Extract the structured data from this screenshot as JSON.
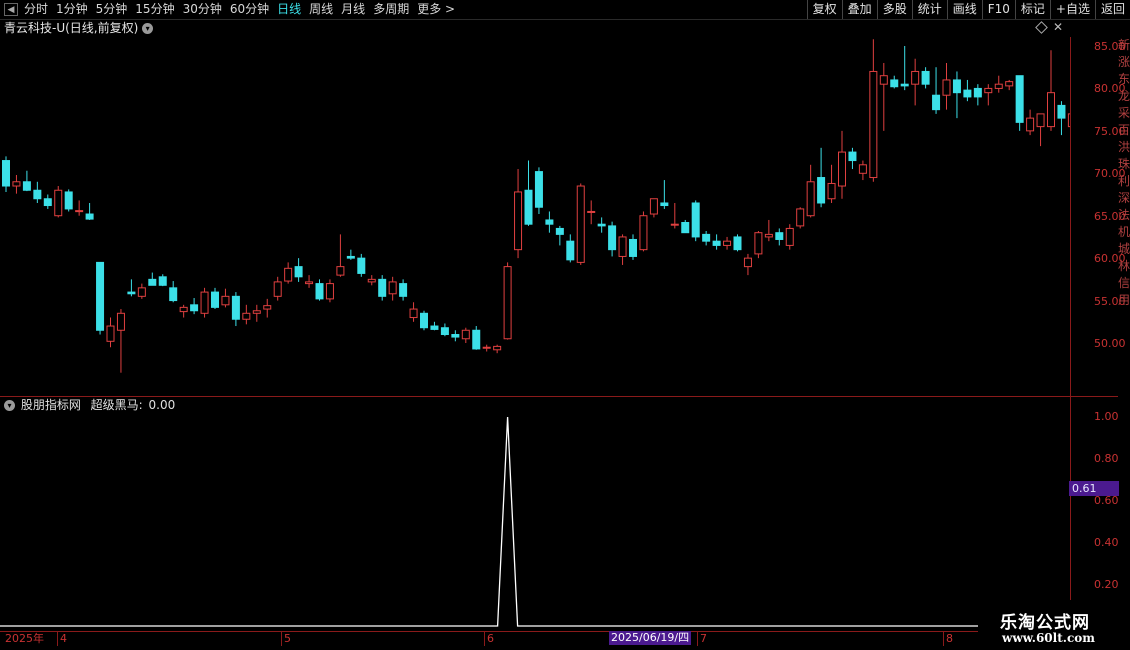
{
  "toolbar": {
    "periods": [
      "分时",
      "1分钟",
      "5分钟",
      "15分钟",
      "30分钟",
      "60分钟",
      "日线",
      "周线",
      "月线",
      "多周期",
      "更多 >"
    ],
    "active_period": "日线",
    "buttons": [
      "复权",
      "叠加",
      "多股",
      "统计",
      "画线",
      "F10",
      "标记",
      "+自选",
      "返回"
    ]
  },
  "stock": {
    "title": "青云科技-U(日线,前复权)"
  },
  "price_axis": [
    "85.00",
    "80.00",
    "75.00",
    "70.00",
    "65.00",
    "60.00",
    "55.00",
    "50.00"
  ],
  "indicator": {
    "name": "股朋指标网",
    "series_label": "超级黑马:",
    "series_value": "0.00",
    "axis": [
      "1.00",
      "0.80",
      "0.60",
      "0.40",
      "0.20"
    ],
    "cursor_value": "0.61"
  },
  "date_axis": {
    "labels": [
      "2025年",
      "4",
      "5",
      "6",
      "7",
      "8"
    ],
    "cursor": "2025/06/19/四"
  },
  "right_edge_text": "新涨东龙采百洪珠利深法机城林信用",
  "logo": {
    "name": "乐淘公式网",
    "url": "www.60lt.com"
  },
  "colors": {
    "up": "#e04040",
    "down": "#3ce0e8",
    "axis": "#8a1a1a",
    "active": "#3ce0e8"
  },
  "chart_data": {
    "type": "candlestick",
    "price_ylim": [
      45,
      87
    ],
    "indicator_ylim": [
      0,
      1.05
    ],
    "candles": [
      [
        71.5,
        72.0,
        67.8,
        68.5
      ],
      [
        68.5,
        69.8,
        67.6,
        69.0
      ],
      [
        69.0,
        70.3,
        67.9,
        68.0
      ],
      [
        68.0,
        69.0,
        66.5,
        67.0
      ],
      [
        67.0,
        67.5,
        65.8,
        66.2
      ],
      [
        65.0,
        68.5,
        64.8,
        68.0
      ],
      [
        67.8,
        68.1,
        65.5,
        65.8
      ],
      [
        65.5,
        66.8,
        65.0,
        65.6
      ],
      [
        65.2,
        66.5,
        64.5,
        64.6
      ],
      [
        59.5,
        59.5,
        51.0,
        51.5
      ],
      [
        50.2,
        53.0,
        49.5,
        52.0
      ],
      [
        51.5,
        54.0,
        46.5,
        53.5
      ],
      [
        56.0,
        57.5,
        55.5,
        55.8
      ],
      [
        55.5,
        57.0,
        55.2,
        56.5
      ],
      [
        57.5,
        58.3,
        57.0,
        56.8
      ],
      [
        57.8,
        58.1,
        56.7,
        56.8
      ],
      [
        56.5,
        57.3,
        54.8,
        55.0
      ],
      [
        53.7,
        54.5,
        53.0,
        54.2
      ],
      [
        54.5,
        55.3,
        53.4,
        53.8
      ],
      [
        53.5,
        56.5,
        53.0,
        56.0
      ],
      [
        56.0,
        56.5,
        54.0,
        54.2
      ],
      [
        54.5,
        56.4,
        54.2,
        55.5
      ],
      [
        55.5,
        56.0,
        52.0,
        52.8
      ],
      [
        52.8,
        54.5,
        52.2,
        53.5
      ],
      [
        53.5,
        54.5,
        52.5,
        53.8
      ],
      [
        54.0,
        55.2,
        53.0,
        54.4
      ],
      [
        55.5,
        57.8,
        55.0,
        57.2
      ],
      [
        57.3,
        59.5,
        57.0,
        58.8
      ],
      [
        59.0,
        60.0,
        57.2,
        57.8
      ],
      [
        57.0,
        58.0,
        56.5,
        57.2
      ],
      [
        57.0,
        57.5,
        55.0,
        55.2
      ],
      [
        55.2,
        57.5,
        54.8,
        57.0
      ],
      [
        58.0,
        62.8,
        57.8,
        59.0
      ],
      [
        60.2,
        61.0,
        59.8,
        60.0
      ],
      [
        60.0,
        60.5,
        57.8,
        58.2
      ],
      [
        57.2,
        58.0,
        56.8,
        57.5
      ],
      [
        57.5,
        58.0,
        55.0,
        55.5
      ],
      [
        55.8,
        57.8,
        55.0,
        57.2
      ],
      [
        57.0,
        57.5,
        55.0,
        55.5
      ],
      [
        53.0,
        54.8,
        52.5,
        54.0
      ],
      [
        53.5,
        53.8,
        51.5,
        51.8
      ],
      [
        52.0,
        52.5,
        51.5,
        51.6
      ],
      [
        51.8,
        52.3,
        50.8,
        51.0
      ],
      [
        51.0,
        51.5,
        50.2,
        50.7
      ],
      [
        50.5,
        51.8,
        50.0,
        51.5
      ],
      [
        51.5,
        52.0,
        49.2,
        49.3
      ],
      [
        49.5,
        49.8,
        49.0,
        49.5
      ],
      [
        49.2,
        49.8,
        48.8,
        49.6
      ],
      [
        50.5,
        59.5,
        50.4,
        59.0
      ],
      [
        61.0,
        70.5,
        60.0,
        67.8
      ],
      [
        68.0,
        71.5,
        63.8,
        64.0
      ],
      [
        70.2,
        70.7,
        65.2,
        66.0
      ],
      [
        64.5,
        65.5,
        63.0,
        64.0
      ],
      [
        63.5,
        63.8,
        61.5,
        62.8
      ],
      [
        62.0,
        62.8,
        59.5,
        59.8
      ],
      [
        59.5,
        68.8,
        59.2,
        68.5
      ],
      [
        65.5,
        66.8,
        64.0,
        65.5
      ],
      [
        64.0,
        64.8,
        63.0,
        63.8
      ],
      [
        63.8,
        64.3,
        60.2,
        61.0
      ],
      [
        60.2,
        62.8,
        59.2,
        62.5
      ],
      [
        62.2,
        62.8,
        59.8,
        60.2
      ],
      [
        61.0,
        65.5,
        60.8,
        65.0
      ],
      [
        65.2,
        67.0,
        64.8,
        67.0
      ],
      [
        66.5,
        69.2,
        65.8,
        66.2
      ],
      [
        64.0,
        66.5,
        63.5,
        64.0
      ],
      [
        64.2,
        64.5,
        63.5,
        63.0
      ],
      [
        66.5,
        66.8,
        62.0,
        62.5
      ],
      [
        62.8,
        63.2,
        61.5,
        62.0
      ],
      [
        62.0,
        62.8,
        61.0,
        61.5
      ],
      [
        61.5,
        62.5,
        61.0,
        62.0
      ],
      [
        62.5,
        62.8,
        60.8,
        61.0
      ],
      [
        59.0,
        60.5,
        58.0,
        60.0
      ],
      [
        60.5,
        63.2,
        60.0,
        63.0
      ],
      [
        62.5,
        64.5,
        62.0,
        62.8
      ],
      [
        63.0,
        63.5,
        61.5,
        62.2
      ],
      [
        61.5,
        64.0,
        61.0,
        63.5
      ],
      [
        63.8,
        66.0,
        63.5,
        65.8
      ],
      [
        65.0,
        71.0,
        64.8,
        69.0
      ],
      [
        69.5,
        73.0,
        66.0,
        66.5
      ],
      [
        67.0,
        71.0,
        66.5,
        68.8
      ],
      [
        68.5,
        75.0,
        67.0,
        72.5
      ],
      [
        72.5,
        73.0,
        70.5,
        71.5
      ],
      [
        70.0,
        71.5,
        69.2,
        71.0
      ],
      [
        69.5,
        85.8,
        69.0,
        82.0
      ],
      [
        80.5,
        83.0,
        75.0,
        81.5
      ],
      [
        81.0,
        81.5,
        80.0,
        80.2
      ],
      [
        80.5,
        85.0,
        79.8,
        80.3
      ],
      [
        80.5,
        83.5,
        78.0,
        82.0
      ],
      [
        82.0,
        82.5,
        80.0,
        80.5
      ],
      [
        79.2,
        82.5,
        77.0,
        77.5
      ],
      [
        79.2,
        83.0,
        77.5,
        81.0
      ],
      [
        81.0,
        82.0,
        76.5,
        79.5
      ],
      [
        79.8,
        81.0,
        78.5,
        79.0
      ],
      [
        80.0,
        80.5,
        78.0,
        79.0
      ],
      [
        79.5,
        80.5,
        78.0,
        80.0
      ],
      [
        80.0,
        81.5,
        79.5,
        80.5
      ],
      [
        80.3,
        81.0,
        79.8,
        80.8
      ],
      [
        81.5,
        81.5,
        75.0,
        76.0
      ],
      [
        75.0,
        77.5,
        74.5,
        76.5
      ],
      [
        75.5,
        76.5,
        73.2,
        77.0
      ],
      [
        75.5,
        84.5,
        75.0,
        79.5
      ],
      [
        78.0,
        78.5,
        74.5,
        76.5
      ],
      [
        75.5,
        77.5,
        74.8,
        77.0
      ],
      [
        75.0,
        77.5,
        74.5,
        77.0
      ],
      [
        77.0,
        79.5,
        76.5,
        78.5
      ]
    ],
    "indicator_values_nonzero": {
      "index": 48,
      "value": 1.0
    }
  }
}
